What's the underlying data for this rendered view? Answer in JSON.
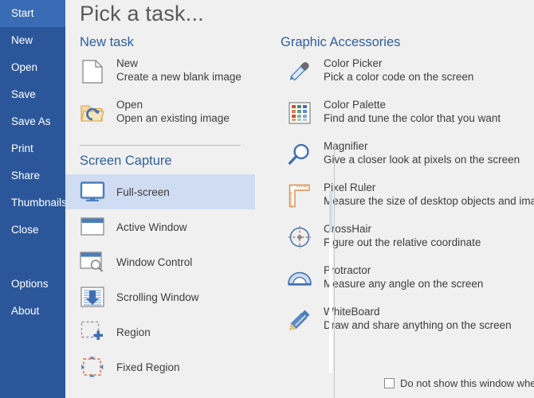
{
  "sidebar": {
    "items": [
      {
        "label": "Start",
        "active": true
      },
      {
        "label": "New",
        "active": false
      },
      {
        "label": "Open",
        "active": false
      },
      {
        "label": "Save",
        "active": false
      },
      {
        "label": "Save As",
        "active": false
      },
      {
        "label": "Print",
        "active": false
      },
      {
        "label": "Share",
        "active": false
      },
      {
        "label": "Thumbnails",
        "active": false
      },
      {
        "label": "Close",
        "active": false
      },
      {
        "label": "Options",
        "active": false
      },
      {
        "label": "About",
        "active": false
      }
    ],
    "bg_color": "#2b579a",
    "active_color": "#3a6cb5"
  },
  "header": {
    "title": "Pick a task..."
  },
  "sections": {
    "new_task": {
      "heading": "New task",
      "items": [
        {
          "icon": "new-document-icon",
          "title": "New",
          "description": "Create a new blank image"
        },
        {
          "icon": "open-folder-icon",
          "title": "Open",
          "description": "Open an existing image"
        }
      ]
    },
    "screen_capture": {
      "heading": "Screen Capture",
      "items": [
        {
          "icon": "monitor-icon",
          "label": "Full-screen",
          "selected": true
        },
        {
          "icon": "active-window-icon",
          "label": "Active Window",
          "selected": false
        },
        {
          "icon": "window-control-icon",
          "label": "Window Control",
          "selected": false
        },
        {
          "icon": "scrolling-window-icon",
          "label": "Scrolling Window",
          "selected": false
        },
        {
          "icon": "region-icon",
          "label": "Region",
          "selected": false
        },
        {
          "icon": "fixed-region-icon",
          "label": "Fixed Region",
          "selected": false
        }
      ]
    },
    "graphic_accessories": {
      "heading": "Graphic Accessories",
      "items": [
        {
          "icon": "eyedropper-icon",
          "title": "Color Picker",
          "description": "Pick a color code on the screen"
        },
        {
          "icon": "color-palette-icon",
          "title": "Color Palette",
          "description": "Find and tune the color that you want"
        },
        {
          "icon": "magnifier-icon",
          "title": "Magnifier",
          "description": "Give a closer look at pixels on the screen"
        },
        {
          "icon": "ruler-icon",
          "title": "Pixel Ruler",
          "description": "Measure the size of desktop objects and image"
        },
        {
          "icon": "crosshair-icon",
          "title": "CrossHair",
          "description": "Figure out the relative coordinate"
        },
        {
          "icon": "protractor-icon",
          "title": "Protractor",
          "description": "Measure any angle on the screen"
        },
        {
          "icon": "pen-icon",
          "title": "WhiteBoard",
          "description": "Draw and share anything on the screen"
        }
      ]
    }
  },
  "footer": {
    "checkbox_label": "Do not show this window when program starts",
    "checked": false
  },
  "colors": {
    "heading_blue": "#2e5f9e",
    "body_text": "#3d3d3d",
    "title_gray": "#595959",
    "selection": "#cfdcf1",
    "icon_blue": "#4a7ebb",
    "icon_orange": "#e08a4a",
    "background": "#f0f0f0"
  }
}
